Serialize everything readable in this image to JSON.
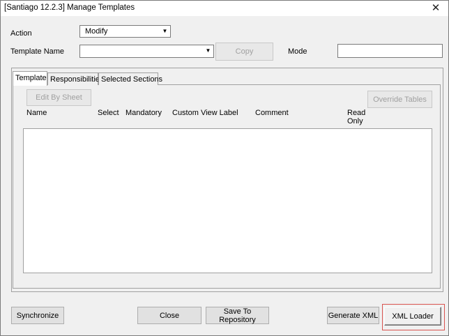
{
  "window": {
    "title": "[Santiago 12.2.3] Manage Templates",
    "close_glyph": "✕"
  },
  "form": {
    "action_label": "Action",
    "action_value": "Modify",
    "template_name_label": "Template Name",
    "template_name_value": "",
    "copy_button": "Copy",
    "mode_label": "Mode",
    "mode_value": ""
  },
  "tabs": [
    {
      "label": "Template",
      "active": true
    },
    {
      "label": "Responsibilities",
      "active": false
    },
    {
      "label": "Selected Sections",
      "active": false
    }
  ],
  "template_tab": {
    "edit_by_sheet_button": "Edit By Sheet",
    "override_tables_button": "Override Tables",
    "columns": [
      "Name",
      "Select",
      "Mandatory",
      "Custom View Label",
      "Comment",
      "Read Only"
    ],
    "rows": []
  },
  "footer": {
    "synchronize": "Synchronize",
    "close": "Close",
    "save_to_repository": "Save To Repository",
    "generate_xml": "Generate XML",
    "xml_loader": "XML Loader"
  },
  "icons": {
    "dropdown": "chevron-down-icon",
    "close": "close-icon"
  },
  "colors": {
    "highlight": "#d9534f",
    "background": "#f0f0f0"
  }
}
